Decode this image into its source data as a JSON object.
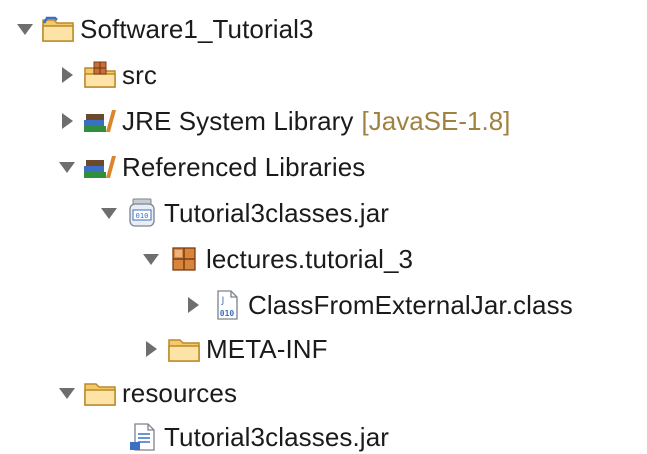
{
  "explorer": {
    "items": [
      {
        "label": "Software1_Tutorial3",
        "decoration": "",
        "icon": "project-folder-icon",
        "state": "expanded"
      },
      {
        "label": "src",
        "decoration": "",
        "icon": "source-folder-icon",
        "state": "collapsed"
      },
      {
        "label": "JRE System Library",
        "decoration": "[JavaSE-1.8]",
        "icon": "library-icon",
        "state": "collapsed"
      },
      {
        "label": "Referenced Libraries",
        "decoration": "",
        "icon": "library-icon",
        "state": "expanded"
      },
      {
        "label": "Tutorial3classes.jar",
        "decoration": "",
        "icon": "jar-icon",
        "state": "expanded"
      },
      {
        "label": "lectures.tutorial_3",
        "decoration": "",
        "icon": "package-icon",
        "state": "expanded"
      },
      {
        "label": "ClassFromExternalJar.class",
        "decoration": "",
        "icon": "class-file-icon",
        "state": "collapsed"
      },
      {
        "label": "META-INF",
        "decoration": "",
        "icon": "folder-icon",
        "state": "collapsed"
      },
      {
        "label": "resources",
        "decoration": "",
        "icon": "folder-icon",
        "state": "expanded"
      },
      {
        "label": "Tutorial3classes.jar",
        "decoration": "",
        "icon": "file-icon",
        "state": "leaf"
      }
    ]
  },
  "colors": {
    "decoration": "#a08240",
    "twisty": "#6e6e6e",
    "folder": "#f2b44a"
  }
}
